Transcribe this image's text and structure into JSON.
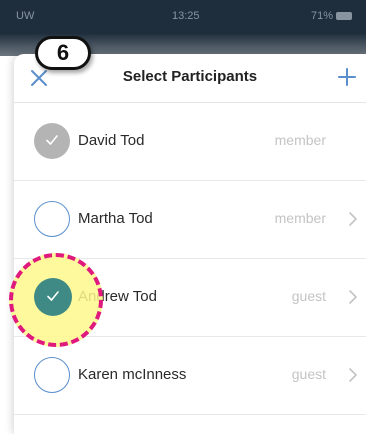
{
  "status_bar": {
    "carrier": "UW",
    "time": "13:25",
    "battery": "71%"
  },
  "header": {
    "title": "Select Participants",
    "close_icon": "close-icon",
    "add_icon": "plus-icon"
  },
  "participants": [
    {
      "name": "David Tod",
      "role": "member",
      "selected": true,
      "selection_style": "grey",
      "has_chevron": false
    },
    {
      "name": "Martha Tod",
      "role": "member",
      "selected": false,
      "has_chevron": true
    },
    {
      "name": "Andrew Tod",
      "role": "guest",
      "selected": true,
      "selection_style": "teal",
      "has_chevron": true
    },
    {
      "name": "Karen mcInness",
      "role": "guest",
      "selected": false,
      "has_chevron": true
    }
  ],
  "annotation": {
    "step_number": "6",
    "highlight_color": "#fff88c",
    "border_color": "#e0197d"
  },
  "colors": {
    "accent": "#5b8fcc",
    "selected_teal": "#3f8a84",
    "selected_grey": "#b4b4b4",
    "status_bar_bg": "#1f2e3d"
  }
}
